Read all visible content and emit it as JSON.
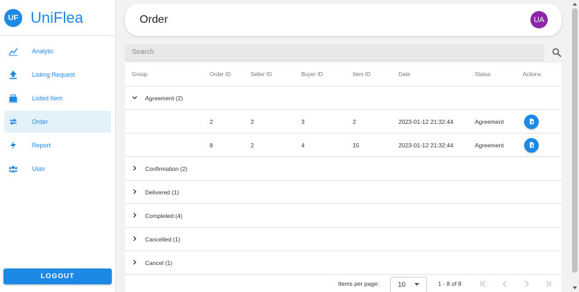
{
  "brand": {
    "logo": "UF",
    "name": "UniFlea"
  },
  "sidebar": {
    "items": [
      {
        "label": "Analytic",
        "icon": "chart-line-icon"
      },
      {
        "label": "Listing Request",
        "icon": "upload-icon"
      },
      {
        "label": "Listed Item",
        "icon": "inventory-icon"
      },
      {
        "label": "Order",
        "icon": "swap-icon"
      },
      {
        "label": "Report",
        "icon": "report-icon"
      },
      {
        "label": "User",
        "icon": "users-icon"
      }
    ],
    "logout": "LOGOUT"
  },
  "header": {
    "title": "Order",
    "avatar": "UA"
  },
  "search": {
    "placeholder": "Search"
  },
  "table": {
    "columns": [
      "Group",
      "Order ID",
      "Seller ID",
      "Buyer ID",
      "Item ID",
      "Date",
      "Status",
      "Actions"
    ],
    "groups": [
      {
        "label": "Agreement (2)",
        "expanded": true
      },
      {
        "label": "Confirmation (2)",
        "expanded": false
      },
      {
        "label": "Delivered (1)",
        "expanded": false
      },
      {
        "label": "Completed (4)",
        "expanded": false
      },
      {
        "label": "Cancelled (1)",
        "expanded": false
      },
      {
        "label": "Cancel (1)",
        "expanded": false
      }
    ],
    "rows": [
      {
        "order_id": "2",
        "seller_id": "2",
        "buyer_id": "3",
        "item_id": "2",
        "date": "2023-01-12 21:32:44",
        "status": "Agreement"
      },
      {
        "order_id": "8",
        "seller_id": "2",
        "buyer_id": "4",
        "item_id": "15",
        "date": "2023-01-12 21:32:44",
        "status": "Agreement"
      }
    ]
  },
  "pagination": {
    "items_per_page_label": "Items per page:",
    "page_size": "10",
    "range": "1 - 8 of 8"
  },
  "colors": {
    "accent": "#1e88e5",
    "avatar": "#8e24aa",
    "active_bg": "#e3f1fb"
  }
}
